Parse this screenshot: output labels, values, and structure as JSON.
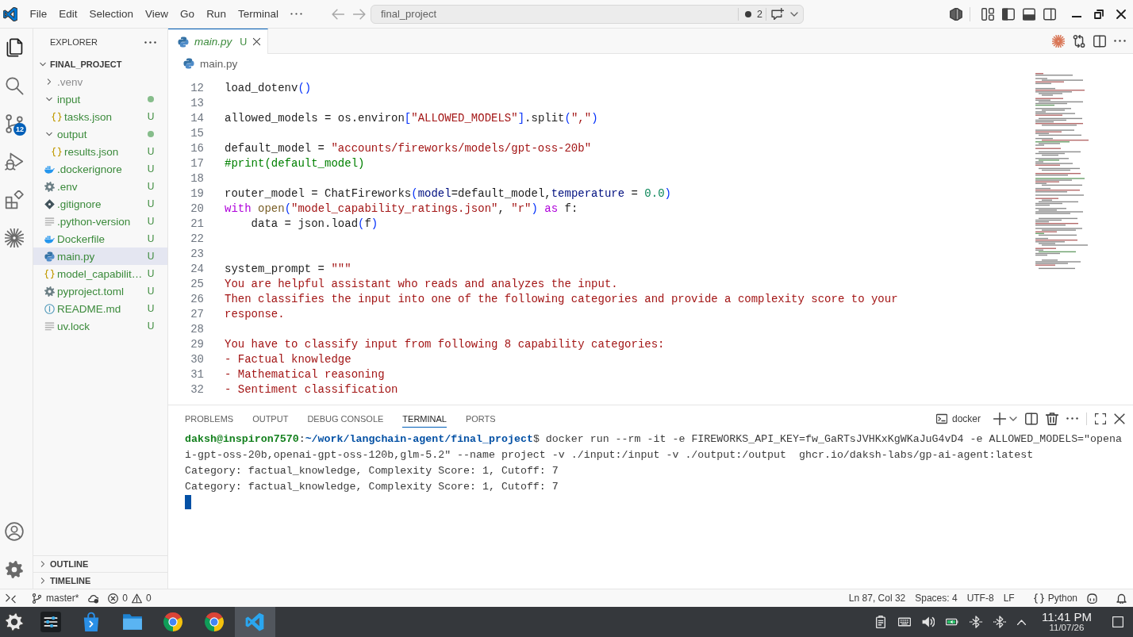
{
  "title_bar": {
    "menus": [
      "File",
      "Edit",
      "Selection",
      "View",
      "Go",
      "Run",
      "Terminal"
    ],
    "command_center": {
      "value": "final_project",
      "count": "2"
    },
    "layout_toggles": [
      {
        "kind": "primary-sidebar",
        "on": true
      },
      {
        "kind": "panel",
        "on": true
      },
      {
        "kind": "secondary-sidebar",
        "on": false
      }
    ]
  },
  "activity_bar": {
    "items": [
      {
        "kind": "explorer",
        "selected": true
      },
      {
        "kind": "search",
        "selected": false
      },
      {
        "kind": "source-control",
        "selected": false,
        "badge": "12"
      },
      {
        "kind": "run-debug",
        "selected": false
      },
      {
        "kind": "extensions",
        "selected": false
      },
      {
        "kind": "asterisk",
        "selected": false
      }
    ]
  },
  "sidebar": {
    "title": "EXPLORER",
    "root": {
      "label": "FINAL_PROJECT",
      "expanded": true,
      "items": [
        {
          "name": ".venv",
          "kind": "folder",
          "untracked": false,
          "ignored": true,
          "expanded": false,
          "changes_dot": false,
          "selected": false
        },
        {
          "name": "input",
          "kind": "folder",
          "untracked": true,
          "ignored": false,
          "expanded": true,
          "changes_dot": true,
          "selected": false,
          "children": [
            {
              "name": "tasks.json",
              "kind": "json",
              "untracked": true,
              "ignored": false,
              "badge": "U",
              "selected": false
            }
          ]
        },
        {
          "name": "output",
          "kind": "folder",
          "untracked": true,
          "ignored": false,
          "expanded": true,
          "changes_dot": true,
          "selected": false,
          "children": [
            {
              "name": "results.json",
              "kind": "json",
              "untracked": true,
              "ignored": false,
              "badge": "U",
              "selected": false
            }
          ]
        },
        {
          "name": ".dockerignore",
          "kind": "docker",
          "untracked": true,
          "ignored": false,
          "badge": "U",
          "selected": false
        },
        {
          "name": ".env",
          "kind": "config",
          "untracked": true,
          "ignored": false,
          "badge": "U",
          "selected": false
        },
        {
          "name": ".gitignore",
          "kind": "git",
          "untracked": true,
          "ignored": false,
          "badge": "U",
          "selected": false
        },
        {
          "name": ".python-version",
          "kind": "text",
          "untracked": true,
          "ignored": false,
          "badge": "U",
          "selected": false
        },
        {
          "name": "Dockerfile",
          "kind": "docker",
          "untracked": true,
          "ignored": false,
          "badge": "U",
          "selected": false
        },
        {
          "name": "main.py",
          "kind": "python",
          "untracked": true,
          "ignored": false,
          "badge": "U",
          "selected": true
        },
        {
          "name": "model_capabilit…",
          "kind": "json",
          "untracked": true,
          "ignored": false,
          "badge": "U",
          "selected": false
        },
        {
          "name": "pyproject.toml",
          "kind": "config",
          "untracked": true,
          "ignored": false,
          "badge": "U",
          "selected": false
        },
        {
          "name": "README.md",
          "kind": "info",
          "untracked": true,
          "ignored": false,
          "badge": "U",
          "selected": false
        },
        {
          "name": "uv.lock",
          "kind": "text",
          "untracked": true,
          "ignored": false,
          "badge": "U",
          "selected": false
        }
      ]
    },
    "sections": [
      {
        "label": "OUTLINE",
        "expanded": false
      },
      {
        "label": "TIMELINE",
        "expanded": false
      }
    ]
  },
  "editor": {
    "tabs": [
      {
        "label": "main.py",
        "kind": "python",
        "badge": "U",
        "untracked": true,
        "preview": true,
        "selected": true
      }
    ],
    "breadcrumb": [
      {
        "label": "main.py",
        "kind": "python"
      }
    ],
    "lines": [
      {
        "number": "12",
        "tokens": [
          {
            "kind": "plain",
            "text": "load_dotenv"
          },
          {
            "kind": "bracket",
            "text": "()"
          }
        ]
      },
      {
        "number": "13"
      },
      {
        "number": "14",
        "tokens": [
          {
            "kind": "plain",
            "text": "allowed_models = os.environ"
          },
          {
            "kind": "bracket",
            "text": "["
          },
          {
            "kind": "string",
            "text": "\"ALLOWED_MODELS\""
          },
          {
            "kind": "bracket",
            "text": "]"
          },
          {
            "kind": "plain",
            "text": ".split"
          },
          {
            "kind": "bracket",
            "text": "("
          },
          {
            "kind": "string",
            "text": "\",\""
          },
          {
            "kind": "bracket",
            "text": ")"
          }
        ]
      },
      {
        "number": "15"
      },
      {
        "number": "16",
        "tokens": [
          {
            "kind": "plain",
            "text": "default_model = "
          },
          {
            "kind": "string",
            "text": "\"accounts/fireworks/models/gpt-oss-20b\""
          }
        ]
      },
      {
        "number": "17",
        "tokens": [
          {
            "kind": "comment",
            "text": "#print(default_model)"
          }
        ]
      },
      {
        "number": "18"
      },
      {
        "number": "19",
        "tokens": [
          {
            "kind": "plain",
            "text": "router_model = ChatFireworks"
          },
          {
            "kind": "bracket",
            "text": "("
          },
          {
            "kind": "param",
            "text": "model"
          },
          {
            "kind": "plain",
            "text": "=default_model,"
          },
          {
            "kind": "param",
            "text": "temperature"
          },
          {
            "kind": "plain",
            "text": " = "
          },
          {
            "kind": "number",
            "text": "0.0"
          },
          {
            "kind": "bracket",
            "text": ")"
          }
        ]
      },
      {
        "number": "20",
        "tokens": [
          {
            "kind": "keyword",
            "text": "with"
          },
          {
            "kind": "function",
            "text": " open"
          },
          {
            "kind": "bracket",
            "text": "("
          },
          {
            "kind": "string",
            "text": "\"model_capability_ratings.json\""
          },
          {
            "kind": "plain",
            "text": ", "
          },
          {
            "kind": "string",
            "text": "\"r\""
          },
          {
            "kind": "bracket",
            "text": ")"
          },
          {
            "kind": "keyword",
            "text": " as"
          },
          {
            "kind": "plain",
            "text": " f:"
          }
        ]
      },
      {
        "number": "21",
        "tokens": [
          {
            "kind": "plain",
            "text": "    data = json.load"
          },
          {
            "kind": "bracket",
            "text": "("
          },
          {
            "kind": "plain",
            "text": "f"
          },
          {
            "kind": "bracket",
            "text": ")"
          }
        ]
      },
      {
        "number": "22"
      },
      {
        "number": "23"
      },
      {
        "number": "24",
        "tokens": [
          {
            "kind": "plain",
            "text": "system_prompt = "
          },
          {
            "kind": "string",
            "text": "\"\"\""
          }
        ]
      },
      {
        "number": "25",
        "tokens": [
          {
            "kind": "string",
            "text": "You are helpful assistant who reads and analyzes the input."
          }
        ]
      },
      {
        "number": "26",
        "tokens": [
          {
            "kind": "string",
            "text": "Then classifies the input into one of the following categories and provide a complexity score to your"
          }
        ]
      },
      {
        "number": "27",
        "tokens": [
          {
            "kind": "string",
            "text": "response."
          }
        ]
      },
      {
        "number": "28"
      },
      {
        "number": "29",
        "tokens": [
          {
            "kind": "string",
            "text": "You have to classify input from following 8 capability categories:"
          }
        ]
      },
      {
        "number": "30",
        "tokens": [
          {
            "kind": "string",
            "text": "- Factual knowledge"
          }
        ]
      },
      {
        "number": "31",
        "tokens": [
          {
            "kind": "string",
            "text": "- Mathematical reasoning"
          }
        ]
      },
      {
        "number": "32",
        "tokens": [
          {
            "kind": "string",
            "text": "- Sentiment classification"
          }
        ]
      }
    ]
  },
  "panel": {
    "tabs": [
      {
        "label": "PROBLEMS",
        "selected": false
      },
      {
        "label": "OUTPUT",
        "selected": false
      },
      {
        "label": "DEBUG CONSOLE",
        "selected": false
      },
      {
        "label": "TERMINAL",
        "selected": true
      },
      {
        "label": "PORTS",
        "selected": false
      }
    ],
    "terminal_name": "docker",
    "terminal": {
      "prompt": {
        "user": "daksh@inspiron7570",
        "separator": ":",
        "cwd": "~/work/langchain-agent/final_project",
        "command": "$ docker run --rm -it -e FIREWORKS_API_KEY=fw_GaRTsJVHKxKgWKaJuG4vD4 -e ALLOWED_MODELS=\"openai-gpt-oss-20b,openai-gpt-oss-120b,glm-5.2\" --name project -v ./input:/input -v ./output:/output  ghcr.io/daksh-labs/gp-ai-agent:latest"
      },
      "output": [
        "Category: factual_knowledge, Complexity Score: 1, Cutoff: 7",
        "Category: factual_knowledge, Complexity Score: 1, Cutoff: 7"
      ]
    }
  },
  "status_bar": {
    "branch": "master*",
    "errors": "0",
    "warnings": "0",
    "position": "Ln 87, Col 32",
    "indentation": "Spaces: 4",
    "encoding": "UTF-8",
    "line_ending": "LF",
    "language": "Python"
  },
  "taskbar": {
    "apps": [
      {
        "kind": "settings",
        "selected": false
      },
      {
        "kind": "store",
        "selected": false
      },
      {
        "kind": "files",
        "selected": false
      },
      {
        "kind": "browser",
        "selected": false
      },
      {
        "kind": "browser",
        "selected": false
      },
      {
        "kind": "code-editor",
        "selected": true
      }
    ],
    "time": "11:41 PM",
    "date": "11/07/26"
  }
}
